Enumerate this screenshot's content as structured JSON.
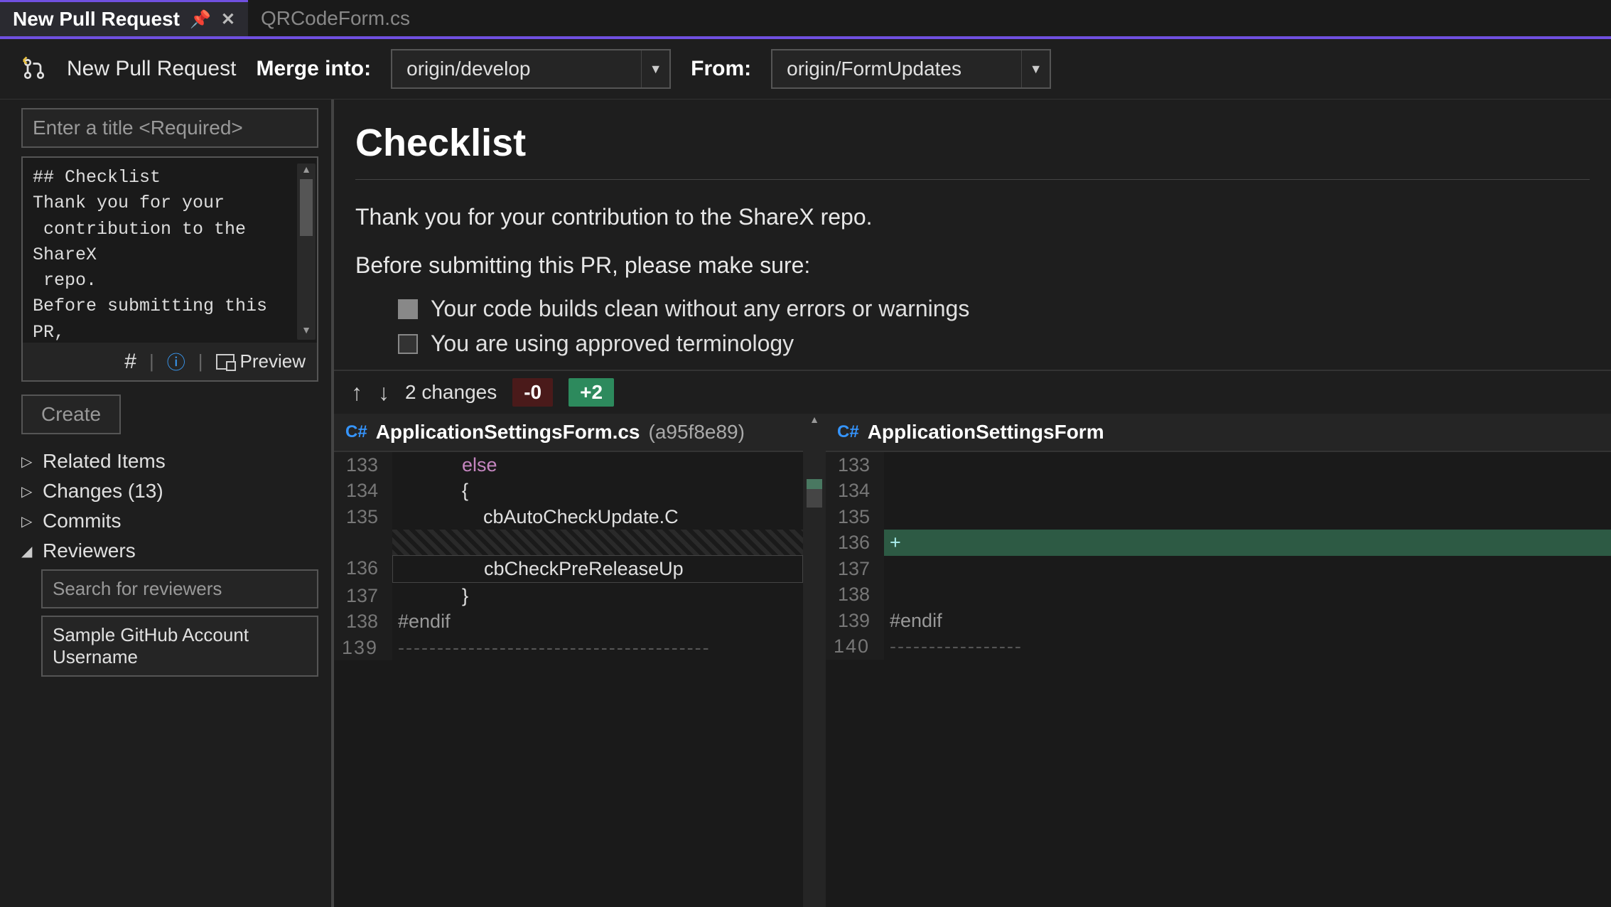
{
  "tabs": {
    "active": "New Pull Request",
    "inactive": "QRCodeForm.cs"
  },
  "toolbar": {
    "title": "New Pull Request",
    "merge_into_label": "Merge into:",
    "merge_into_value": "origin/develop",
    "from_label": "From:",
    "from_value": "origin/FormUpdates"
  },
  "left": {
    "title_placeholder": "Enter a title <Required>",
    "description": "## Checklist\nThank you for your\n contribution to the ShareX\n repo.\nBefore submitting this PR,\n please make sure:\n\n- [x] Your code builds",
    "preview_label": "Preview",
    "create_label": "Create",
    "tree": {
      "related": "Related Items",
      "changes": "Changes (13)",
      "commits": "Commits",
      "reviewers": "Reviewers"
    },
    "reviewer_search_placeholder": "Search for reviewers",
    "reviewer_sample": "Sample GitHub Account Username"
  },
  "preview": {
    "heading": "Checklist",
    "p1": "Thank you for your contribution to the ShareX repo.",
    "p2": "Before submitting this PR, please make sure:",
    "item1": "Your code builds clean without any errors or warnings",
    "item2": "You are using approved terminology"
  },
  "diff": {
    "changes_text": "2 changes",
    "minus": "-0",
    "plus": "+2",
    "left_file": "ApplicationSettingsForm.cs",
    "left_hash": "(a95f8e89)",
    "right_file": "ApplicationSettingsForm",
    "cs_label": "C#",
    "left_lines": [
      {
        "n": "133",
        "t": "            else",
        "cls": ""
      },
      {
        "n": "134",
        "t": "            {",
        "cls": ""
      },
      {
        "n": "135",
        "t": "                cbAutoCheckUpdate.C",
        "cls": ""
      },
      {
        "n": "",
        "t": "",
        "cls": "hatched"
      },
      {
        "n": "136",
        "t": "                cbCheckPreReleaseUp",
        "cls": "boxed"
      },
      {
        "n": "137",
        "t": "            }",
        "cls": ""
      },
      {
        "n": "138",
        "t": "#endif",
        "cls": "pp"
      },
      {
        "n": "139",
        "t": "----------------------------------------",
        "cls": "dots"
      }
    ],
    "right_lines": [
      {
        "n": "133",
        "t": "",
        "cls": ""
      },
      {
        "n": "134",
        "t": "",
        "cls": ""
      },
      {
        "n": "135",
        "t": "",
        "cls": ""
      },
      {
        "n": "136",
        "t": "",
        "cls": "added"
      },
      {
        "n": "137",
        "t": "",
        "cls": ""
      },
      {
        "n": "138",
        "t": "",
        "cls": ""
      },
      {
        "n": "139",
        "t": "#endif",
        "cls": "pp"
      },
      {
        "n": "140",
        "t": "-----------------",
        "cls": "dots"
      }
    ]
  }
}
